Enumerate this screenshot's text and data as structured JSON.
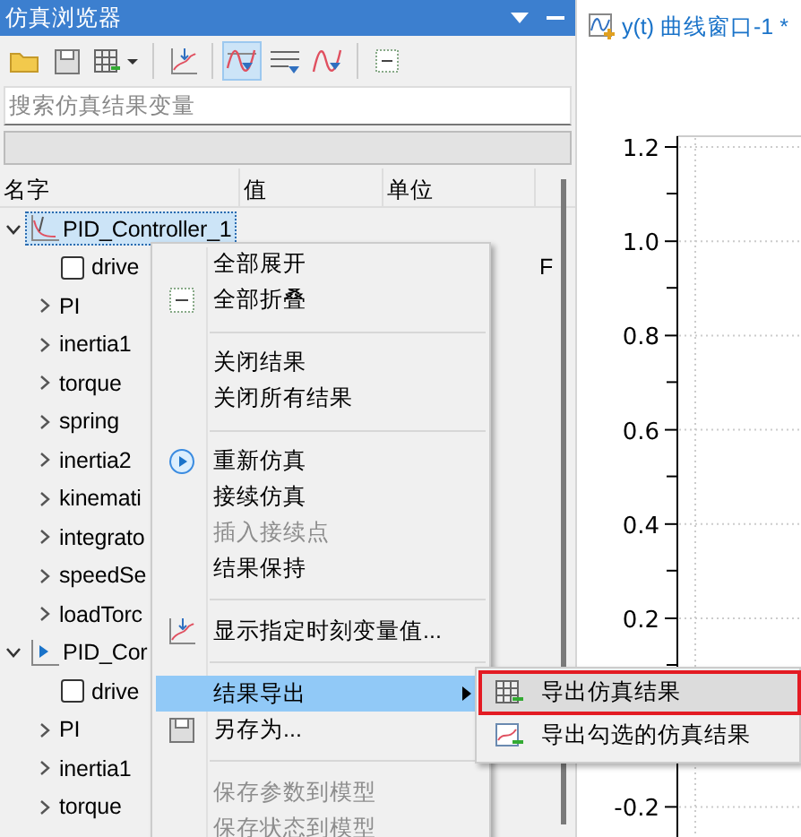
{
  "browser": {
    "title": "仿真浏览器",
    "toolbar": [
      {
        "pressed": false
      },
      {
        "pressed": false
      },
      {
        "pressed": false
      },
      {
        "pressed": false
      },
      {
        "pressed": true
      },
      {
        "pressed": false
      },
      {
        "pressed": false
      },
      {
        "pressed": false
      }
    ],
    "search": {
      "placeholder": "搜索仿真结果变量"
    },
    "columns": [
      "名字",
      "值",
      "单位"
    ],
    "tree": [
      {
        "label": "PID_Controller_1",
        "kind": "plot-result",
        "expanded": true,
        "selected": true,
        "children": [
          {
            "label": "drive",
            "kind": "variable",
            "checked": false,
            "column_4": "F"
          },
          {
            "label": "PI",
            "kind": "component",
            "expanded": false
          },
          {
            "label": "inertia1",
            "kind": "component",
            "expanded": false
          },
          {
            "label": "torque",
            "kind": "component",
            "expanded": false
          },
          {
            "label": "spring",
            "kind": "component",
            "expanded": false
          },
          {
            "label": "inertia2",
            "kind": "component",
            "expanded": false
          },
          {
            "label": "kinemati",
            "kind": "component",
            "expanded": false
          },
          {
            "label": "integrato",
            "kind": "component",
            "expanded": false
          },
          {
            "label": "speedSe",
            "kind": "component",
            "expanded": false
          },
          {
            "label": "loadTorc",
            "kind": "component",
            "expanded": false
          }
        ]
      },
      {
        "label": "PID_Cor",
        "kind": "sim-result",
        "expanded": true,
        "selected": false,
        "children": [
          {
            "label": "drive",
            "kind": "variable",
            "checked": false
          },
          {
            "label": "PI",
            "kind": "component",
            "expanded": false
          },
          {
            "label": "inertia1",
            "kind": "component",
            "expanded": false
          },
          {
            "label": "torque",
            "kind": "component",
            "expanded": false
          }
        ]
      }
    ]
  },
  "plot_tab": {
    "title": "y(t) 曲线窗口-1 *",
    "plot": {
      "y_axis_labels": [
        "1.2",
        "1.0",
        "0.8",
        "0.6",
        "0.4",
        "0.2",
        "-0.2"
      ]
    }
  },
  "context_menu": {
    "items": [
      {
        "kind": "item",
        "label": "全部展开",
        "disabled": false,
        "selected": false
      },
      {
        "kind": "item",
        "label": "全部折叠",
        "disabled": false,
        "selected": false
      },
      {
        "kind": "separator"
      },
      {
        "kind": "item",
        "label": "关闭结果",
        "disabled": false,
        "selected": false
      },
      {
        "kind": "item",
        "label": "关闭所有结果",
        "disabled": false,
        "selected": false
      },
      {
        "kind": "separator"
      },
      {
        "kind": "item",
        "label": "重新仿真",
        "disabled": false,
        "selected": false
      },
      {
        "kind": "item",
        "label": "接续仿真",
        "disabled": false,
        "selected": false
      },
      {
        "kind": "item",
        "label": "插入接续点",
        "disabled": true,
        "selected": false
      },
      {
        "kind": "item",
        "label": "结果保持",
        "disabled": false,
        "selected": false
      },
      {
        "kind": "separator"
      },
      {
        "kind": "item",
        "label": "显示指定时刻变量值...",
        "disabled": false,
        "selected": false
      },
      {
        "kind": "separator"
      },
      {
        "kind": "submenu",
        "label": "结果导出",
        "disabled": false,
        "selected": true
      },
      {
        "kind": "item",
        "label": "另存为...",
        "disabled": false,
        "selected": false
      },
      {
        "kind": "separator"
      },
      {
        "kind": "item",
        "label": "保存参数到模型",
        "disabled": true,
        "selected": false
      },
      {
        "kind": "item",
        "label": "保存状态到模型",
        "disabled": true,
        "selected": false
      }
    ]
  },
  "submenu": {
    "items": [
      {
        "label": "导出仿真结果",
        "selected": true,
        "outlined": true
      },
      {
        "label": "导出勾选的仿真结果",
        "selected": false,
        "outlined": false
      }
    ]
  }
}
